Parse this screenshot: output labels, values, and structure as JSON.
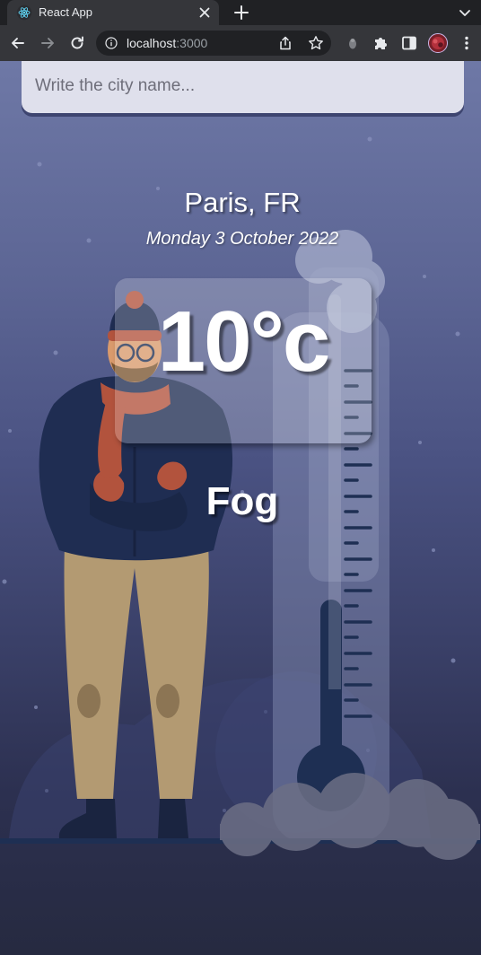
{
  "browser": {
    "tab_title": "React App",
    "url_host": "localhost",
    "url_port": ":3000"
  },
  "search": {
    "placeholder": "Write the city name..."
  },
  "weather": {
    "location": "Paris, FR",
    "date": "Monday 3 October 2022",
    "temperature": "10°c",
    "condition": "Fog"
  },
  "colors": {
    "chrome_dark": "#202124",
    "chrome_toolbar": "#35363a",
    "bg_top": "#6e78a6",
    "bg_bottom": "#262a40",
    "coat": "#1f2d52",
    "trousers": "#b39a72",
    "scarf": "#b2533d"
  },
  "icons": {
    "favicon": "react-icon",
    "back": "arrow-left-icon",
    "forward": "arrow-right-icon",
    "reload": "reload-icon",
    "info": "info-icon",
    "share": "share-icon",
    "bookmark": "star-icon",
    "extension": "puzzle-icon",
    "side_panel": "side-panel-icon",
    "profile": "avatar",
    "menu": "kebab-menu-icon"
  }
}
